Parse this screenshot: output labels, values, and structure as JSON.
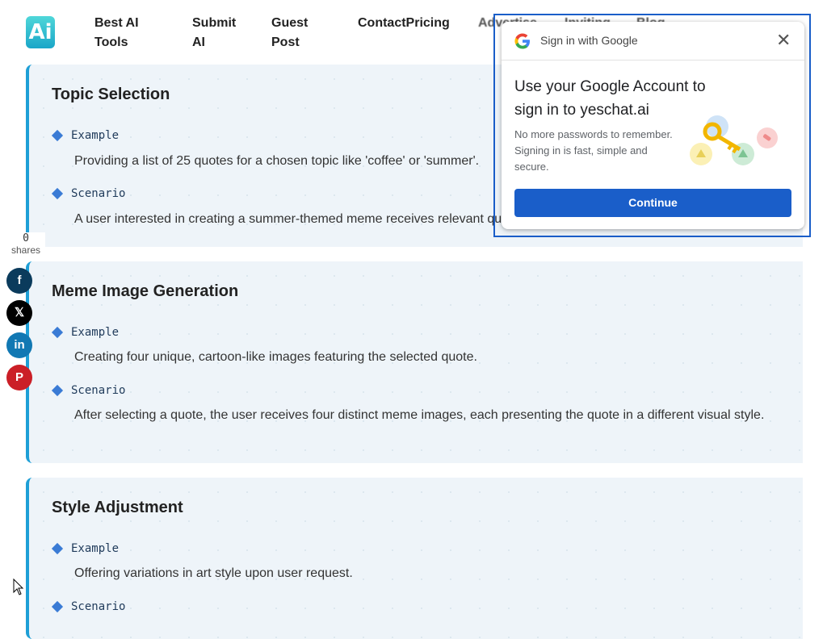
{
  "header": {
    "nav": [
      {
        "label": "Best AI\nTools"
      },
      {
        "label": "Submit\nAI"
      },
      {
        "label": "Guest\nPost"
      },
      {
        "label": "ContactPricing"
      },
      {
        "label": "Advertise"
      },
      {
        "label": "Inviting"
      },
      {
        "label": "Blog"
      }
    ],
    "logo_text": "Ai"
  },
  "cards": [
    {
      "title": "Topic Selection",
      "example_label": "Example",
      "example_text": "Providing a list of 25 quotes for a chosen topic like 'coffee' or 'summer'.",
      "scenario_label": "Scenario",
      "scenario_text": "A user interested in creating a summer-themed meme receives relevant quotes."
    },
    {
      "title": "Meme Image Generation",
      "example_label": "Example",
      "example_text": "Creating four unique, cartoon-like images featuring the selected quote.",
      "scenario_label": "Scenario",
      "scenario_text": "After selecting a quote, the user receives four distinct meme images, each presenting the quote in a different visual style."
    },
    {
      "title": "Style Adjustment",
      "example_label": "Example",
      "example_text": "Offering variations in art style upon user request.",
      "scenario_label": "Scenario"
    }
  ],
  "share": {
    "count": "0",
    "label": "shares",
    "buttons": [
      {
        "name": "facebook",
        "glyph": "f",
        "color": "#0b3b5c"
      },
      {
        "name": "x",
        "glyph": "𝕏",
        "color": "#000000"
      },
      {
        "name": "linkedin",
        "glyph": "in",
        "color": "#1178b3"
      },
      {
        "name": "pinterest",
        "glyph": "P",
        "color": "#cb1f27"
      }
    ]
  },
  "google_popup": {
    "header": "Sign in with Google",
    "heading": "Use your Google Account to sign in to yeschat.ai",
    "body": "No more passwords to remember. Signing in is fast, simple and secure.",
    "continue": "Continue",
    "close_icon": "close-icon",
    "accent": "#1a5ec9"
  }
}
